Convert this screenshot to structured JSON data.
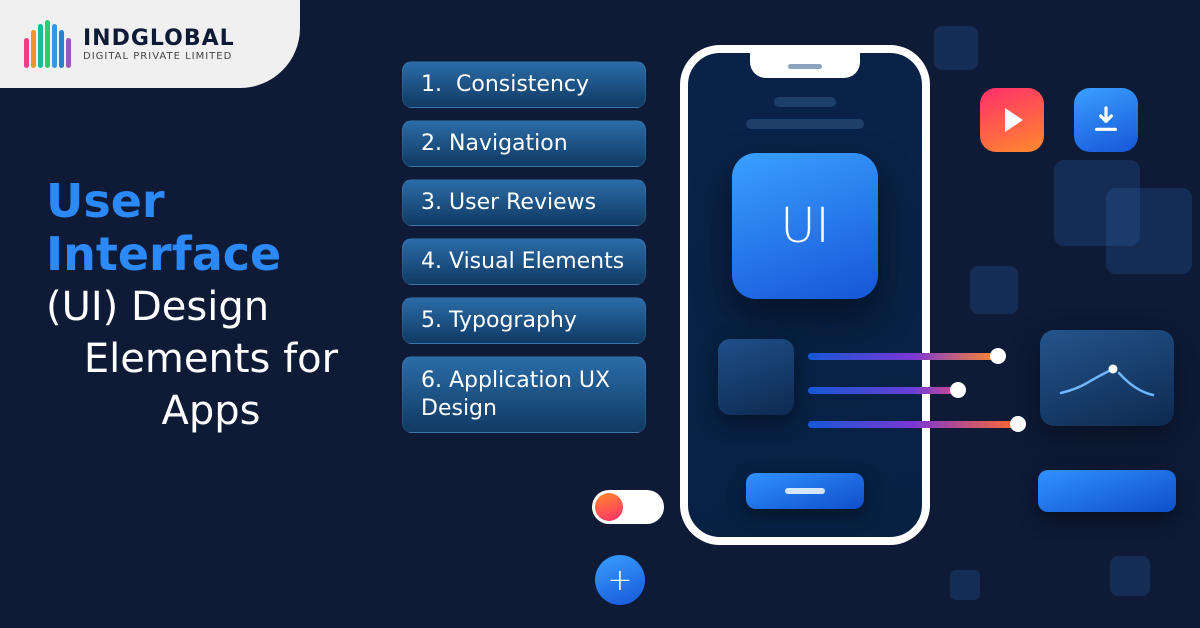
{
  "logo": {
    "brand": "INDGLOBAL",
    "tagline": "DIGITAL PRIVATE LIMITED"
  },
  "headline": {
    "line1": "User Interface",
    "line2": "(UI) Design",
    "line3": "Elements for",
    "line4": "Apps"
  },
  "list": {
    "items": [
      {
        "num": "1.",
        "label": "Consistency"
      },
      {
        "num": "2.",
        "label": "Navigation"
      },
      {
        "num": "3.",
        "label": "User Reviews"
      },
      {
        "num": "4.",
        "label": "Visual Elements"
      },
      {
        "num": "5.",
        "label": "Typography"
      },
      {
        "num": "6.",
        "label": "Application UX Design"
      }
    ]
  },
  "phone": {
    "tile_label": "UI"
  },
  "icons": {
    "play": "play-icon",
    "download": "download-icon",
    "plus": "+"
  },
  "colors": {
    "accent": "#2b8af7",
    "bg": "#0e1a36"
  }
}
